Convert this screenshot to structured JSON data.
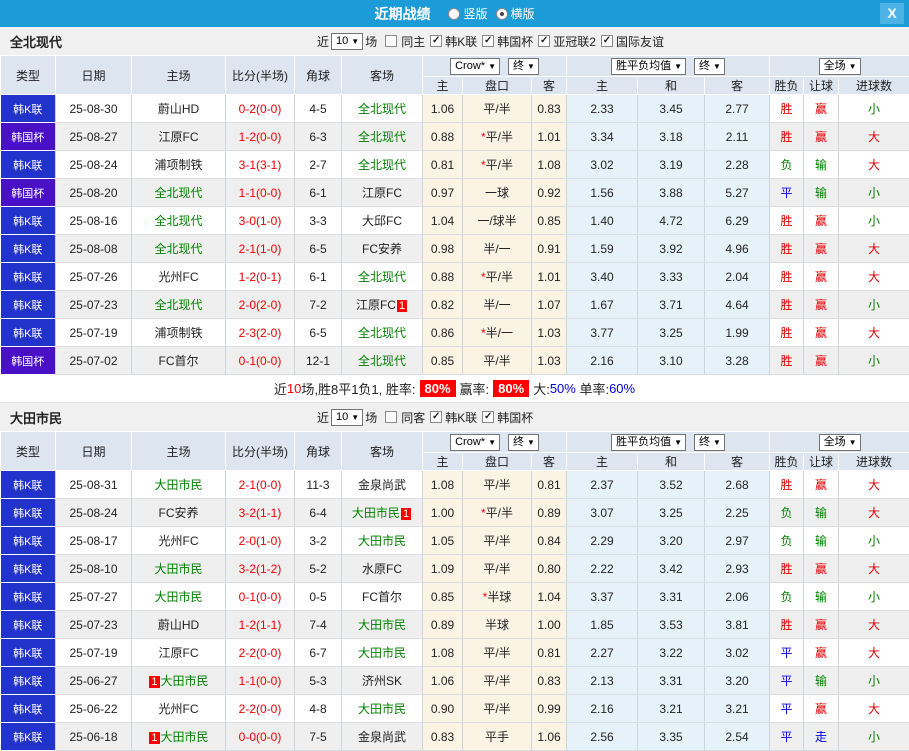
{
  "titlebar": {
    "title": "近期战绩",
    "vertical_label": "竖版",
    "horizontal_label": "横版",
    "close_glyph": "X"
  },
  "columns": {
    "main": [
      "类型",
      "日期",
      "主场",
      "比分(半场)",
      "角球",
      "客场"
    ],
    "sub": [
      "主",
      "盘口",
      "客",
      "主",
      "和",
      "客",
      "胜负",
      "让球",
      "进球数"
    ],
    "selects": {
      "crow": "Crow*",
      "end1": "终",
      "avg": "胜平负均值",
      "end2": "终",
      "full": "全场"
    }
  },
  "palette": {
    "type_bg": {
      "韩K联": "#2233cc",
      "韩国杯": "#4a10c8"
    },
    "result_colors": {
      "胜": "t-red",
      "负": "t-green",
      "平": "t-blue",
      "赢": "t-red",
      "输": "t-green",
      "走": "t-blue",
      "大": "t-red",
      "小": "t-green"
    },
    "accent_blue": "#1b9bd7",
    "red": "#e00000",
    "green": "#008000",
    "blue": "#0000e0"
  },
  "sections": [
    {
      "team": "全北现代",
      "filters": {
        "near_label": "近",
        "count": "10",
        "games_label": "场",
        "same_label": "同主",
        "leagues": [
          "韩K联",
          "韩国杯",
          "亚冠联2",
          "国际友谊"
        ]
      },
      "rows": [
        {
          "type": "韩K联",
          "date": "25-08-30",
          "home": {
            "name": "蔚山HD"
          },
          "score": "0-2(0-0)",
          "corner": "4-5",
          "away": {
            "name": "全北现代",
            "self": true
          },
          "odds": [
            "1.06",
            "平/半",
            "0.83"
          ],
          "avg": [
            "2.33",
            "3.45",
            "2.77"
          ],
          "result": "胜",
          "handicap": "赢",
          "goals": "小"
        },
        {
          "type": "韩国杯",
          "date": "25-08-27",
          "home": {
            "name": "江原FC"
          },
          "score": "1-2(0-0)",
          "corner": "6-3",
          "away": {
            "name": "全北现代",
            "self": true
          },
          "odds": [
            "0.88",
            "*平/半",
            "1.01"
          ],
          "avg": [
            "3.34",
            "3.18",
            "2.11"
          ],
          "result": "胜",
          "handicap": "赢",
          "goals": "大"
        },
        {
          "type": "韩K联",
          "date": "25-08-24",
          "home": {
            "name": "浦项制铁"
          },
          "score": "3-1(3-1)",
          "corner": "2-7",
          "away": {
            "name": "全北现代",
            "self": true
          },
          "odds": [
            "0.81",
            "*平/半",
            "1.08"
          ],
          "avg": [
            "3.02",
            "3.19",
            "2.28"
          ],
          "result": "负",
          "handicap": "输",
          "goals": "大"
        },
        {
          "type": "韩国杯",
          "date": "25-08-20",
          "home": {
            "name": "全北现代",
            "self": true
          },
          "score": "1-1(0-0)",
          "corner": "6-1",
          "away": {
            "name": "江原FC"
          },
          "odds": [
            "0.97",
            "一球",
            "0.92"
          ],
          "avg": [
            "1.56",
            "3.88",
            "5.27"
          ],
          "result": "平",
          "handicap": "输",
          "goals": "小"
        },
        {
          "type": "韩K联",
          "date": "25-08-16",
          "home": {
            "name": "全北现代",
            "self": true
          },
          "score": "3-0(1-0)",
          "corner": "3-3",
          "away": {
            "name": "大邱FC"
          },
          "odds": [
            "1.04",
            "一/球半",
            "0.85"
          ],
          "avg": [
            "1.40",
            "4.72",
            "6.29"
          ],
          "result": "胜",
          "handicap": "赢",
          "goals": "小"
        },
        {
          "type": "韩K联",
          "date": "25-08-08",
          "home": {
            "name": "全北现代",
            "self": true
          },
          "score": "2-1(1-0)",
          "corner": "6-5",
          "away": {
            "name": "FC安养"
          },
          "odds": [
            "0.98",
            "半/一",
            "0.91"
          ],
          "avg": [
            "1.59",
            "3.92",
            "4.96"
          ],
          "result": "胜",
          "handicap": "赢",
          "goals": "大"
        },
        {
          "type": "韩K联",
          "date": "25-07-26",
          "home": {
            "name": "光州FC"
          },
          "score": "1-2(0-1)",
          "corner": "6-1",
          "away": {
            "name": "全北现代",
            "self": true
          },
          "odds": [
            "0.88",
            "*平/半",
            "1.01"
          ],
          "avg": [
            "3.40",
            "3.33",
            "2.04"
          ],
          "result": "胜",
          "handicap": "赢",
          "goals": "大"
        },
        {
          "type": "韩K联",
          "date": "25-07-23",
          "home": {
            "name": "全北现代",
            "self": true
          },
          "score": "2-0(2-0)",
          "corner": "7-2",
          "away": {
            "name": "江原FC",
            "badge": {
              "text": "1",
              "pos": "after"
            }
          },
          "odds": [
            "0.82",
            "半/一",
            "1.07"
          ],
          "avg": [
            "1.67",
            "3.71",
            "4.64"
          ],
          "result": "胜",
          "handicap": "赢",
          "goals": "小"
        },
        {
          "type": "韩K联",
          "date": "25-07-19",
          "home": {
            "name": "浦项制铁"
          },
          "score": "2-3(2-0)",
          "corner": "6-5",
          "away": {
            "name": "全北现代",
            "self": true
          },
          "odds": [
            "0.86",
            "*半/一",
            "1.03"
          ],
          "avg": [
            "3.77",
            "3.25",
            "1.99"
          ],
          "result": "胜",
          "handicap": "赢",
          "goals": "大"
        },
        {
          "type": "韩国杯",
          "date": "25-07-02",
          "home": {
            "name": "FC首尔"
          },
          "score": "0-1(0-0)",
          "corner": "12-1",
          "away": {
            "name": "全北现代",
            "self": true
          },
          "odds": [
            "0.85",
            "平/半",
            "1.03"
          ],
          "avg": [
            "2.16",
            "3.10",
            "3.28"
          ],
          "result": "胜",
          "handicap": "赢",
          "goals": "小"
        }
      ],
      "summary_segments": [
        {
          "t": "近",
          "c": ""
        },
        {
          "t": "10",
          "c": "red"
        },
        {
          "t": "场,胜8平1负1, 胜率:",
          "c": ""
        },
        {
          "t": "80%",
          "c": "ratebox"
        },
        {
          "t": "赢率:",
          "c": ""
        },
        {
          "t": "80%",
          "c": "ratebox"
        },
        {
          "t": "大:",
          "c": ""
        },
        {
          "t": "50%",
          "c": "blue"
        },
        {
          "t": " 单率:",
          "c": ""
        },
        {
          "t": "60%",
          "c": "blue"
        }
      ]
    },
    {
      "team": "大田市民",
      "filters": {
        "near_label": "近",
        "count": "10",
        "games_label": "场",
        "same_label": "同客",
        "leagues": [
          "韩K联",
          "韩国杯"
        ]
      },
      "rows": [
        {
          "type": "韩K联",
          "date": "25-08-31",
          "home": {
            "name": "大田市民",
            "self": true
          },
          "score": "2-1(0-0)",
          "corner": "11-3",
          "away": {
            "name": "金泉尚武"
          },
          "odds": [
            "1.08",
            "平/半",
            "0.81"
          ],
          "avg": [
            "2.37",
            "3.52",
            "2.68"
          ],
          "result": "胜",
          "handicap": "赢",
          "goals": "大"
        },
        {
          "type": "韩K联",
          "date": "25-08-24",
          "home": {
            "name": "FC安养"
          },
          "score": "3-2(1-1)",
          "corner": "6-4",
          "away": {
            "name": "大田市民",
            "self": true,
            "badge": {
              "text": "1",
              "pos": "after"
            }
          },
          "odds": [
            "1.00",
            "*平/半",
            "0.89"
          ],
          "avg": [
            "3.07",
            "3.25",
            "2.25"
          ],
          "result": "负",
          "handicap": "输",
          "goals": "大"
        },
        {
          "type": "韩K联",
          "date": "25-08-17",
          "home": {
            "name": "光州FC"
          },
          "score": "2-0(1-0)",
          "corner": "3-2",
          "away": {
            "name": "大田市民",
            "self": true
          },
          "odds": [
            "1.05",
            "平/半",
            "0.84"
          ],
          "avg": [
            "2.29",
            "3.20",
            "2.97"
          ],
          "result": "负",
          "handicap": "输",
          "goals": "小"
        },
        {
          "type": "韩K联",
          "date": "25-08-10",
          "home": {
            "name": "大田市民",
            "self": true
          },
          "score": "3-2(1-2)",
          "corner": "5-2",
          "away": {
            "name": "水原FC"
          },
          "odds": [
            "1.09",
            "平/半",
            "0.80"
          ],
          "avg": [
            "2.22",
            "3.42",
            "2.93"
          ],
          "result": "胜",
          "handicap": "赢",
          "goals": "大"
        },
        {
          "type": "韩K联",
          "date": "25-07-27",
          "home": {
            "name": "大田市民",
            "self": true
          },
          "score": "0-1(0-0)",
          "corner": "0-5",
          "away": {
            "name": "FC首尔"
          },
          "odds": [
            "0.85",
            "*半球",
            "1.04"
          ],
          "avg": [
            "3.37",
            "3.31",
            "2.06"
          ],
          "result": "负",
          "handicap": "输",
          "goals": "小"
        },
        {
          "type": "韩K联",
          "date": "25-07-23",
          "home": {
            "name": "蔚山HD"
          },
          "score": "1-2(1-1)",
          "corner": "7-4",
          "away": {
            "name": "大田市民",
            "self": true
          },
          "odds": [
            "0.89",
            "半球",
            "1.00"
          ],
          "avg": [
            "1.85",
            "3.53",
            "3.81"
          ],
          "result": "胜",
          "handicap": "赢",
          "goals": "大"
        },
        {
          "type": "韩K联",
          "date": "25-07-19",
          "home": {
            "name": "江原FC"
          },
          "score": "2-2(0-0)",
          "corner": "6-7",
          "away": {
            "name": "大田市民",
            "self": true
          },
          "odds": [
            "1.08",
            "平/半",
            "0.81"
          ],
          "avg": [
            "2.27",
            "3.22",
            "3.02"
          ],
          "result": "平",
          "handicap": "赢",
          "goals": "大"
        },
        {
          "type": "韩K联",
          "date": "25-06-27",
          "home": {
            "name": "大田市民",
            "self": true,
            "badge": {
              "text": "1",
              "pos": "before"
            }
          },
          "score": "1-1(0-0)",
          "corner": "5-3",
          "away": {
            "name": "济州SK"
          },
          "odds": [
            "1.06",
            "平/半",
            "0.83"
          ],
          "avg": [
            "2.13",
            "3.31",
            "3.20"
          ],
          "result": "平",
          "handicap": "输",
          "goals": "小"
        },
        {
          "type": "韩K联",
          "date": "25-06-22",
          "home": {
            "name": "光州FC"
          },
          "score": "2-2(0-0)",
          "corner": "4-8",
          "away": {
            "name": "大田市民",
            "self": true
          },
          "odds": [
            "0.90",
            "平/半",
            "0.99"
          ],
          "avg": [
            "2.16",
            "3.21",
            "3.21"
          ],
          "result": "平",
          "handicap": "赢",
          "goals": "大"
        },
        {
          "type": "韩K联",
          "date": "25-06-18",
          "home": {
            "name": "大田市民",
            "self": true,
            "badge": {
              "text": "1",
              "pos": "before"
            }
          },
          "score": "0-0(0-0)",
          "corner": "7-5",
          "away": {
            "name": "金泉尚武"
          },
          "odds": [
            "0.83",
            "平手",
            "1.06"
          ],
          "avg": [
            "2.56",
            "3.35",
            "2.54"
          ],
          "result": "平",
          "handicap": "走",
          "goals": "小"
        }
      ],
      "summary_segments": null
    }
  ]
}
